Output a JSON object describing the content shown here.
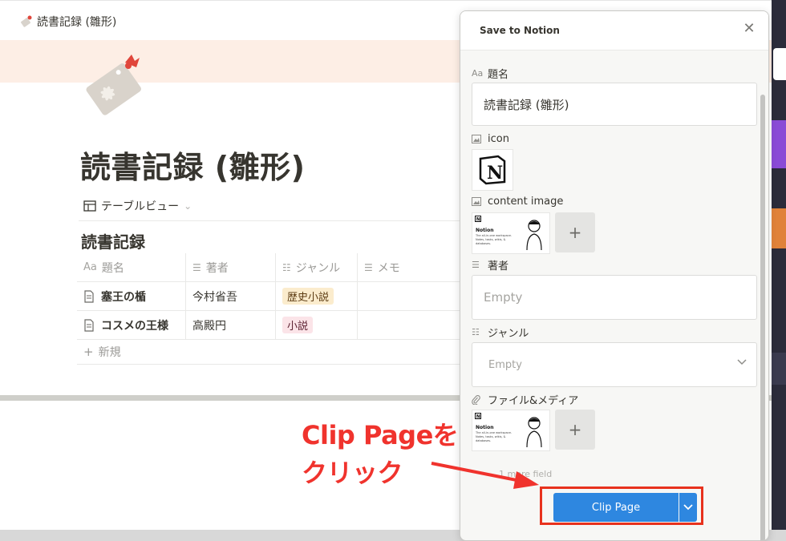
{
  "breadcrumb": {
    "title": "読書記録 (雛形)"
  },
  "page": {
    "title": "読書記録 (雛形)",
    "view_label": "テーブルビュー"
  },
  "database": {
    "title": "読書記録",
    "columns": [
      "題名",
      "著者",
      "ジャンル",
      "メモ"
    ],
    "rows": [
      {
        "title": "塞王の楯",
        "author": "今村省吾",
        "genre": "歴史小説",
        "genre_color": "#fbeccd"
      },
      {
        "title": "コスメの王様",
        "author": "高殿円",
        "genre": "小説",
        "genre_color": "#fbe4e8"
      }
    ],
    "new_label": "新規"
  },
  "clipper": {
    "header": "Save to Notion",
    "props": {
      "title_label": "題名",
      "title_value": "読書記録 (雛形)",
      "icon_label": "icon",
      "content_image_label": "content image",
      "author_label": "著者",
      "author_placeholder": "Empty",
      "genre_label": "ジャンル",
      "genre_placeholder": "Empty",
      "files_label": "ファイル&メディア"
    },
    "thumb": {
      "title": "Notion",
      "subtitle": "The all-in-one workspace. Notes, tasks, wikis, & databases."
    },
    "more_field": "1 more field",
    "clip_button": "Clip Page"
  },
  "annotation": {
    "line1": "Clip Pageを",
    "line2": "クリック",
    "color": "#f0332d"
  },
  "colors": {
    "accent": "#2e87e0",
    "cover": "#fdeee5"
  }
}
